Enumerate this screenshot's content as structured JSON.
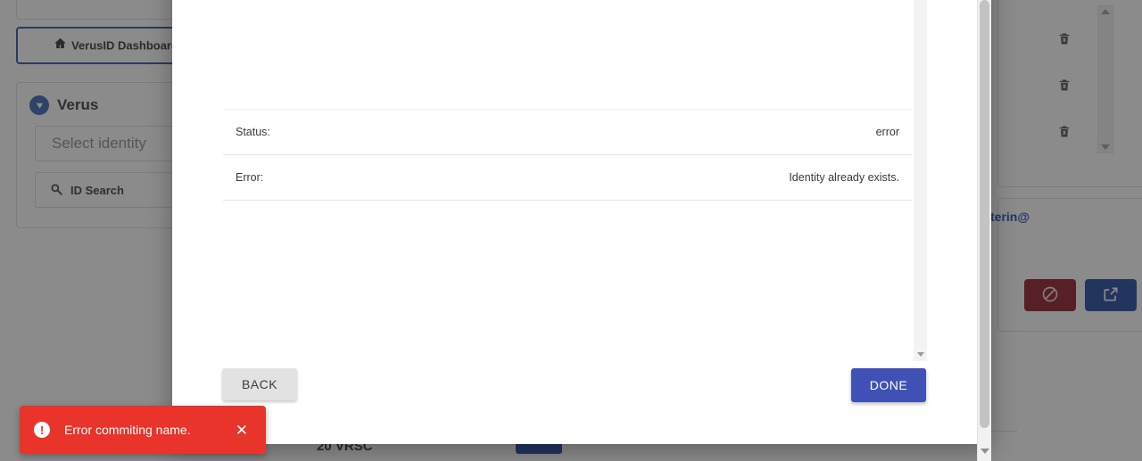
{
  "background": {
    "nav": {
      "label": "VerusID Dashboard",
      "icon": "home-icon",
      "border_color": "#2b4a9b"
    },
    "panel": {
      "brand": "Verus",
      "brand_icon": "verus-logo-icon",
      "select_identity_placeholder": "Select identity",
      "id_search_label": "ID Search",
      "search_icon": "search-icon"
    },
    "right": {
      "trash_icons": [
        "trash-icon",
        "trash-icon",
        "trash-icon"
      ],
      "email_fragment": "terin@",
      "email_color": "#1f3fa0",
      "buttons": [
        {
          "name": "revoke-button",
          "icon": "ban-icon",
          "color": "#8a1220"
        },
        {
          "name": "open-external-button",
          "icon": "external-link-icon",
          "color": "#1a3f9e"
        }
      ]
    },
    "bottom": {
      "amount": "20 VRSC"
    }
  },
  "modal": {
    "rows": [
      {
        "key": "Status:",
        "value": "error"
      },
      {
        "key": "Error:",
        "value": "Identity already exists."
      }
    ],
    "footer": {
      "back_label": "BACK",
      "done_label": "DONE",
      "done_color": "#3f51b5",
      "back_color": "#e2e2e2"
    }
  },
  "toast": {
    "message": "Error commiting name.",
    "icon": "alert-circle-icon",
    "close_icon": "close-icon",
    "background_color": "#e8342a"
  }
}
